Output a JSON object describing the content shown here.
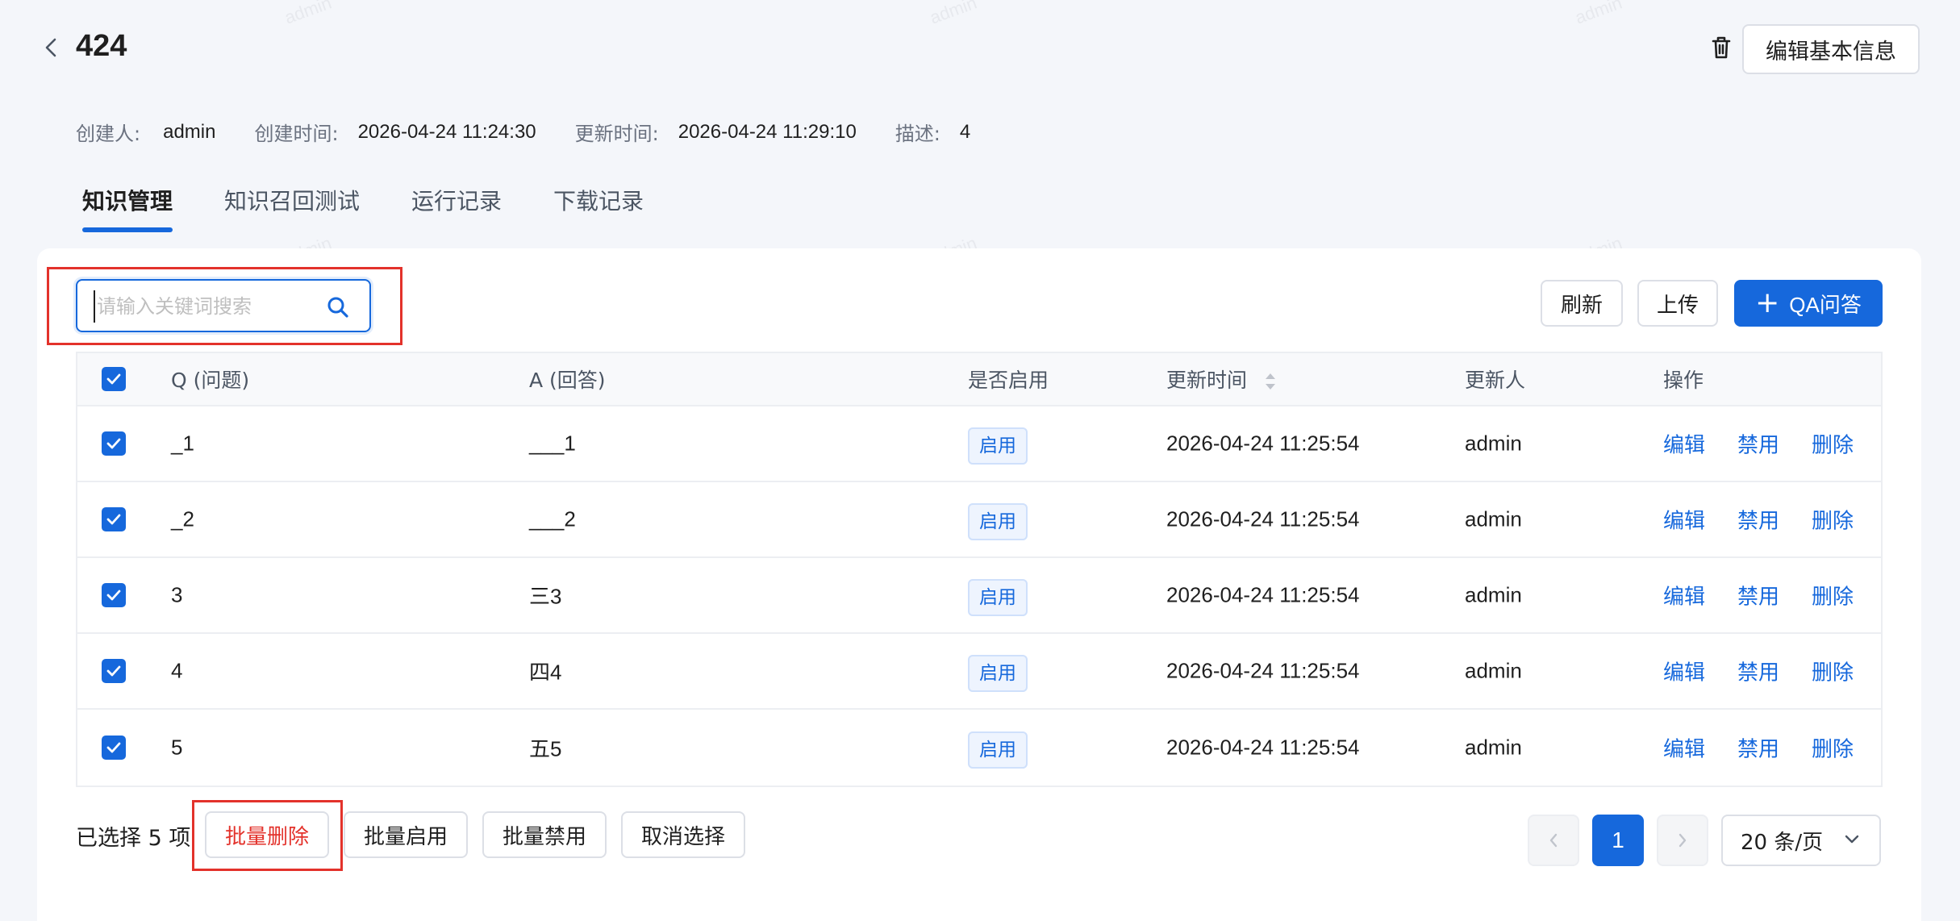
{
  "header": {
    "title": "424",
    "edit_info_label": "编辑基本信息"
  },
  "meta": {
    "creator_label": "创建人:",
    "creator": "admin",
    "created_label": "创建时间:",
    "created": "2026-04-24 11:24:30",
    "updated_label": "更新时间:",
    "updated": "2026-04-24 11:29:10",
    "desc_label": "描述:",
    "desc": "4"
  },
  "tabs": [
    {
      "label": "知识管理",
      "active": true
    },
    {
      "label": "知识召回测试",
      "active": false
    },
    {
      "label": "运行记录",
      "active": false
    },
    {
      "label": "下载记录",
      "active": false
    }
  ],
  "search": {
    "placeholder": "请输入关键词搜索",
    "value": ""
  },
  "toolbar": {
    "refresh": "刷新",
    "upload": "上传",
    "qa": "QA问答"
  },
  "table": {
    "headers": {
      "q": "Q (问题)",
      "a": "A (回答)",
      "enabled": "是否启用",
      "updated_time": "更新时间",
      "updated_by": "更新人",
      "actions": "操作"
    },
    "rows": [
      {
        "q": "_1",
        "a": "___1",
        "status": "启用",
        "time": "2026-04-24 11:25:54",
        "user": "admin",
        "edit": "编辑",
        "disable": "禁用",
        "delete": "删除"
      },
      {
        "q": "_2",
        "a": "___2",
        "status": "启用",
        "time": "2026-04-24 11:25:54",
        "user": "admin",
        "edit": "编辑",
        "disable": "禁用",
        "delete": "删除"
      },
      {
        "q": "3",
        "a": "三3",
        "status": "启用",
        "time": "2026-04-24 11:25:54",
        "user": "admin",
        "edit": "编辑",
        "disable": "禁用",
        "delete": "删除"
      },
      {
        "q": "4",
        "a": "四4",
        "status": "启用",
        "time": "2026-04-24 11:25:54",
        "user": "admin",
        "edit": "编辑",
        "disable": "禁用",
        "delete": "删除"
      },
      {
        "q": "5",
        "a": "五5",
        "status": "启用",
        "time": "2026-04-24 11:25:54",
        "user": "admin",
        "edit": "编辑",
        "disable": "禁用",
        "delete": "删除"
      }
    ]
  },
  "batch": {
    "selected": "已选择 5 项",
    "delete": "批量删除",
    "enable": "批量启用",
    "disable": "批量禁用",
    "cancel": "取消选择"
  },
  "pagination": {
    "current_page": "1",
    "page_size": "20 条/页"
  },
  "watermark": "admin",
  "colors": {
    "primary": "#1668dc",
    "danger": "#e3322b",
    "background": "#f4f6fa"
  }
}
